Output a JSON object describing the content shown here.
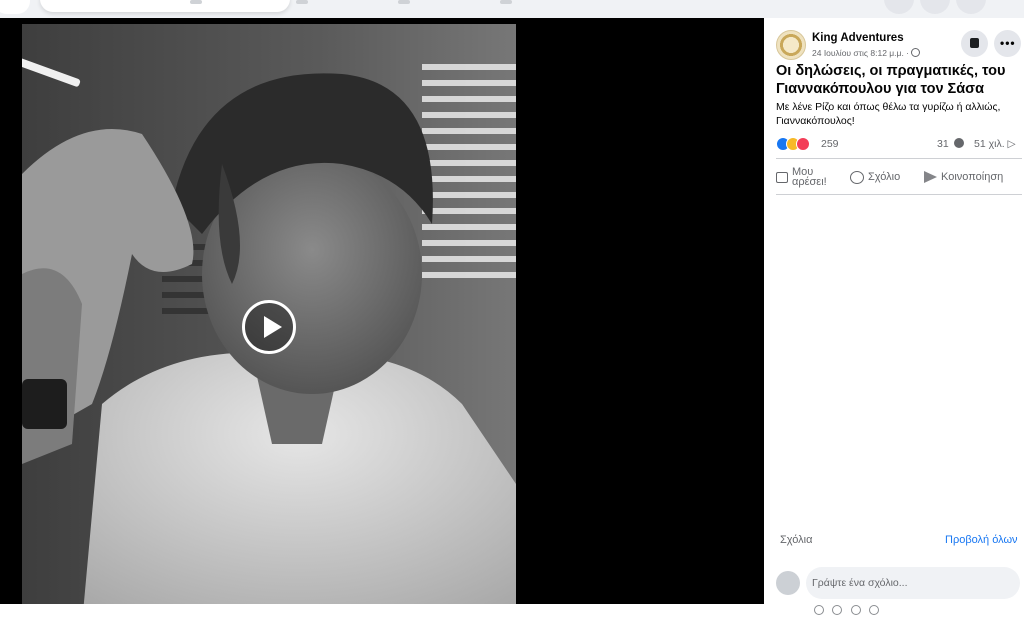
{
  "post": {
    "page_name": "King Adventures",
    "meta": "24 Ιουλίου στις 8:12 μ.μ. ·",
    "title": "Οι δηλώσεις, οι πραγματικές, του Γιαννακόπουλου για τον Σάσα",
    "text": "Με λένε Ρίζο και όπως θέλω τα γυρίζω ή αλλιώς, Γιαννακόπουλος!",
    "reaction_count": "259",
    "comment_count": "31",
    "views": "51 χιλ. ▷"
  },
  "actions": {
    "like": "Μου αρέσει!",
    "comment": "Σχόλιο",
    "share": "Κοινοποίηση"
  },
  "comments": {
    "label": "Σχόλια",
    "view_all": "Προβολή όλων",
    "placeholder": "Γράψτε ένα σχόλιο..."
  },
  "colors": {
    "accent": "#1877f2",
    "secondary_text": "#65676b",
    "video_background": "#000000"
  },
  "icons": [
    "play-icon",
    "globe-icon",
    "save-icon",
    "more-icon",
    "like-icon",
    "comment-icon",
    "share-icon",
    "reaction-like-icon",
    "reaction-haha-icon",
    "reaction-love-icon"
  ]
}
